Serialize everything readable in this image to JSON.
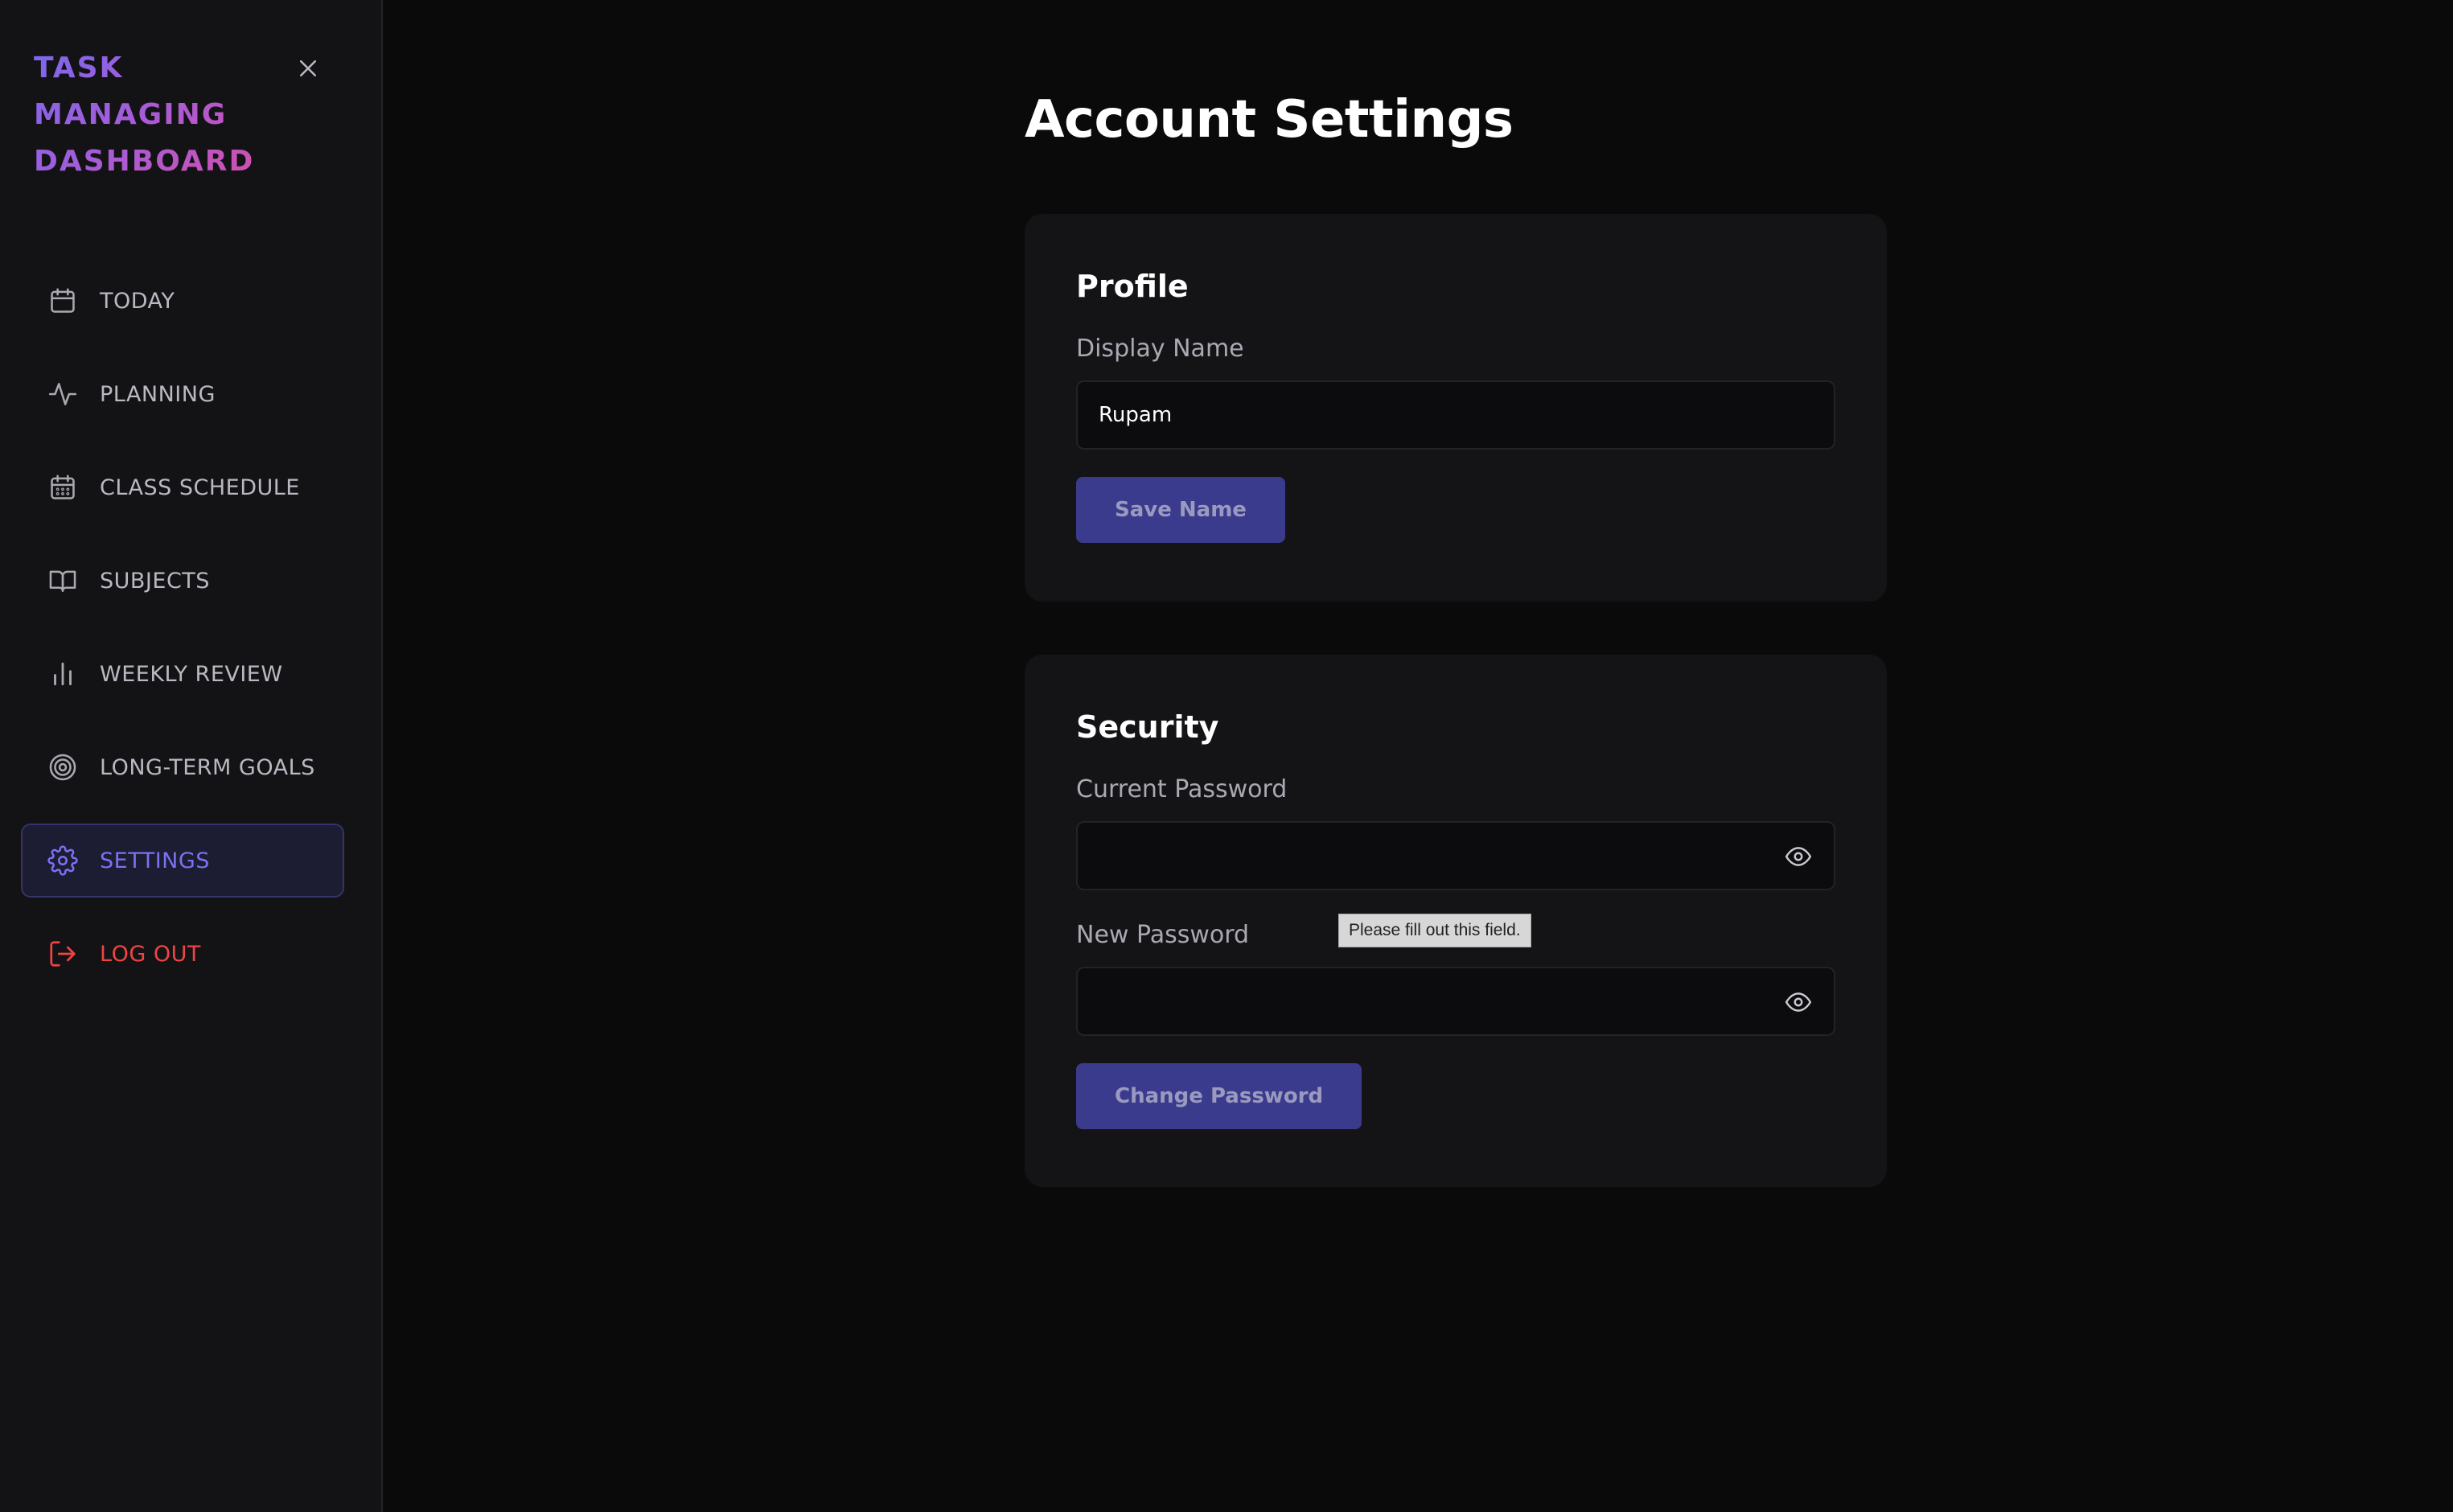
{
  "sidebar": {
    "brand_lines": [
      "TASK",
      "MANAGING",
      "DASHBOARD"
    ],
    "items": [
      {
        "label": "TODAY",
        "icon": "calendar-icon"
      },
      {
        "label": "PLANNING",
        "icon": "activity-icon"
      },
      {
        "label": "CLASS SCHEDULE",
        "icon": "calendar-grid-icon"
      },
      {
        "label": "SUBJECTS",
        "icon": "book-open-icon"
      },
      {
        "label": "WEEKLY REVIEW",
        "icon": "bar-chart-icon"
      },
      {
        "label": "LONG-TERM GOALS",
        "icon": "target-icon"
      },
      {
        "label": "SETTINGS",
        "icon": "gear-icon",
        "active": true
      }
    ],
    "logout_label": "LOG OUT"
  },
  "main": {
    "title": "Account Settings",
    "profile": {
      "heading": "Profile",
      "display_name_label": "Display Name",
      "display_name_value": "Rupam",
      "save_label": "Save Name"
    },
    "security": {
      "heading": "Security",
      "current_password_label": "Current Password",
      "new_password_label": "New Password",
      "change_label": "Change Password"
    },
    "tooltip": "Please fill out this field."
  },
  "colors": {
    "accent": "#7a72f0",
    "button": "#3b3b8d",
    "danger": "#f04444",
    "background": "#0a0a0b",
    "card": "#141417"
  }
}
